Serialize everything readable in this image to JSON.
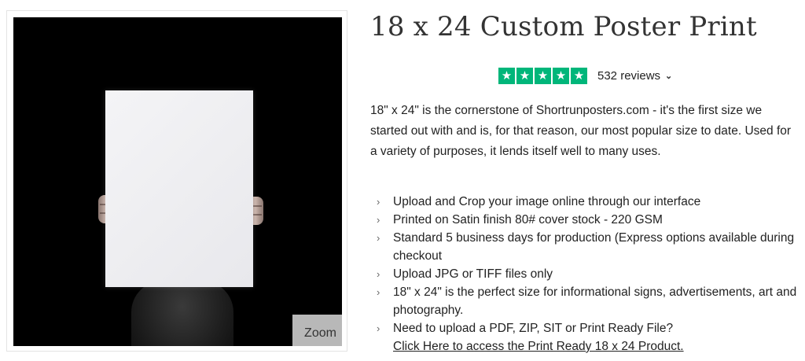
{
  "gallery": {
    "zoom_label": "Zoom"
  },
  "product": {
    "title": "18 x 24 Custom Poster Print",
    "rating": {
      "stars": 5,
      "star_color": "#00b67a",
      "reviews_label": "532 reviews",
      "chevron_icon": "chevron-down-icon"
    },
    "description": "18\" x 24\" is the cornerstone of Shortrunposters.com - it's the first size we started out with and is, for that reason, our most popular size to date. Used for a variety of purposes, it lends itself well to many uses.",
    "features": [
      "Upload and Crop your image online through our interface",
      "Printed on Satin finish 80# cover stock - 220 GSM",
      "Standard 5 business days for production (Express options available during checkout",
      "Upload JPG or TIFF files only",
      "18\" x 24\" is the perfect size for informational signs, advertisements, art and photography.",
      "Need to upload a PDF, ZIP, SIT or Print Ready File?"
    ],
    "print_ready_link": "Click Here to access the Print Ready 18 x 24 Product."
  }
}
